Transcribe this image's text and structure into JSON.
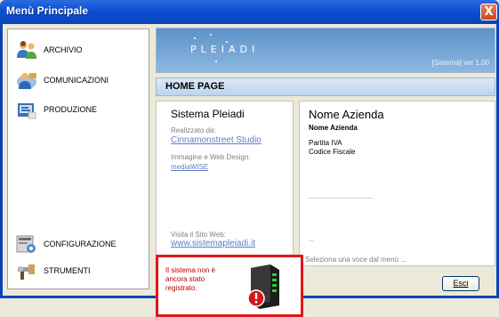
{
  "window": {
    "title": "Menù Principale",
    "close_glyph": "X"
  },
  "nav": {
    "items": [
      {
        "label": "ARCHIVIO",
        "icon": "users-icon"
      },
      {
        "label": "COMUNICAZIONI",
        "icon": "contact-icon"
      },
      {
        "label": "PRODUZIONE",
        "icon": "production-icon"
      },
      {
        "label": "CONFIGURAZIONE",
        "icon": "configuration-icon"
      },
      {
        "label": "STRUMENTI",
        "icon": "tools-icon"
      }
    ]
  },
  "banner": {
    "logo": "PLEIADI",
    "version": "[Sistema]  ver 1.00"
  },
  "homepage": {
    "title": "HOME PAGE"
  },
  "info_panel": {
    "title": "Sistema Pleiadi",
    "created_by_label": "Realizzato da:",
    "created_by_link": "Cinnamonstreet Studio",
    "design_label": "Immagine e Web Design:",
    "design_link": "mediaWISE",
    "visit_label": "Visita il Sito Web:",
    "visit_link": "www.sistemapleiadi.it"
  },
  "company_panel": {
    "title": "Nome Azienda",
    "name": "Nome Azienda",
    "vat_label": "Partita IVA",
    "tax_label": "Codice Fiscale",
    "dots": "..."
  },
  "warning": {
    "message": "Il sistema non è ancora stato registrato."
  },
  "status": {
    "text": "Seleziona una voce dal menù ..."
  },
  "buttons": {
    "exit": "Esci"
  }
}
